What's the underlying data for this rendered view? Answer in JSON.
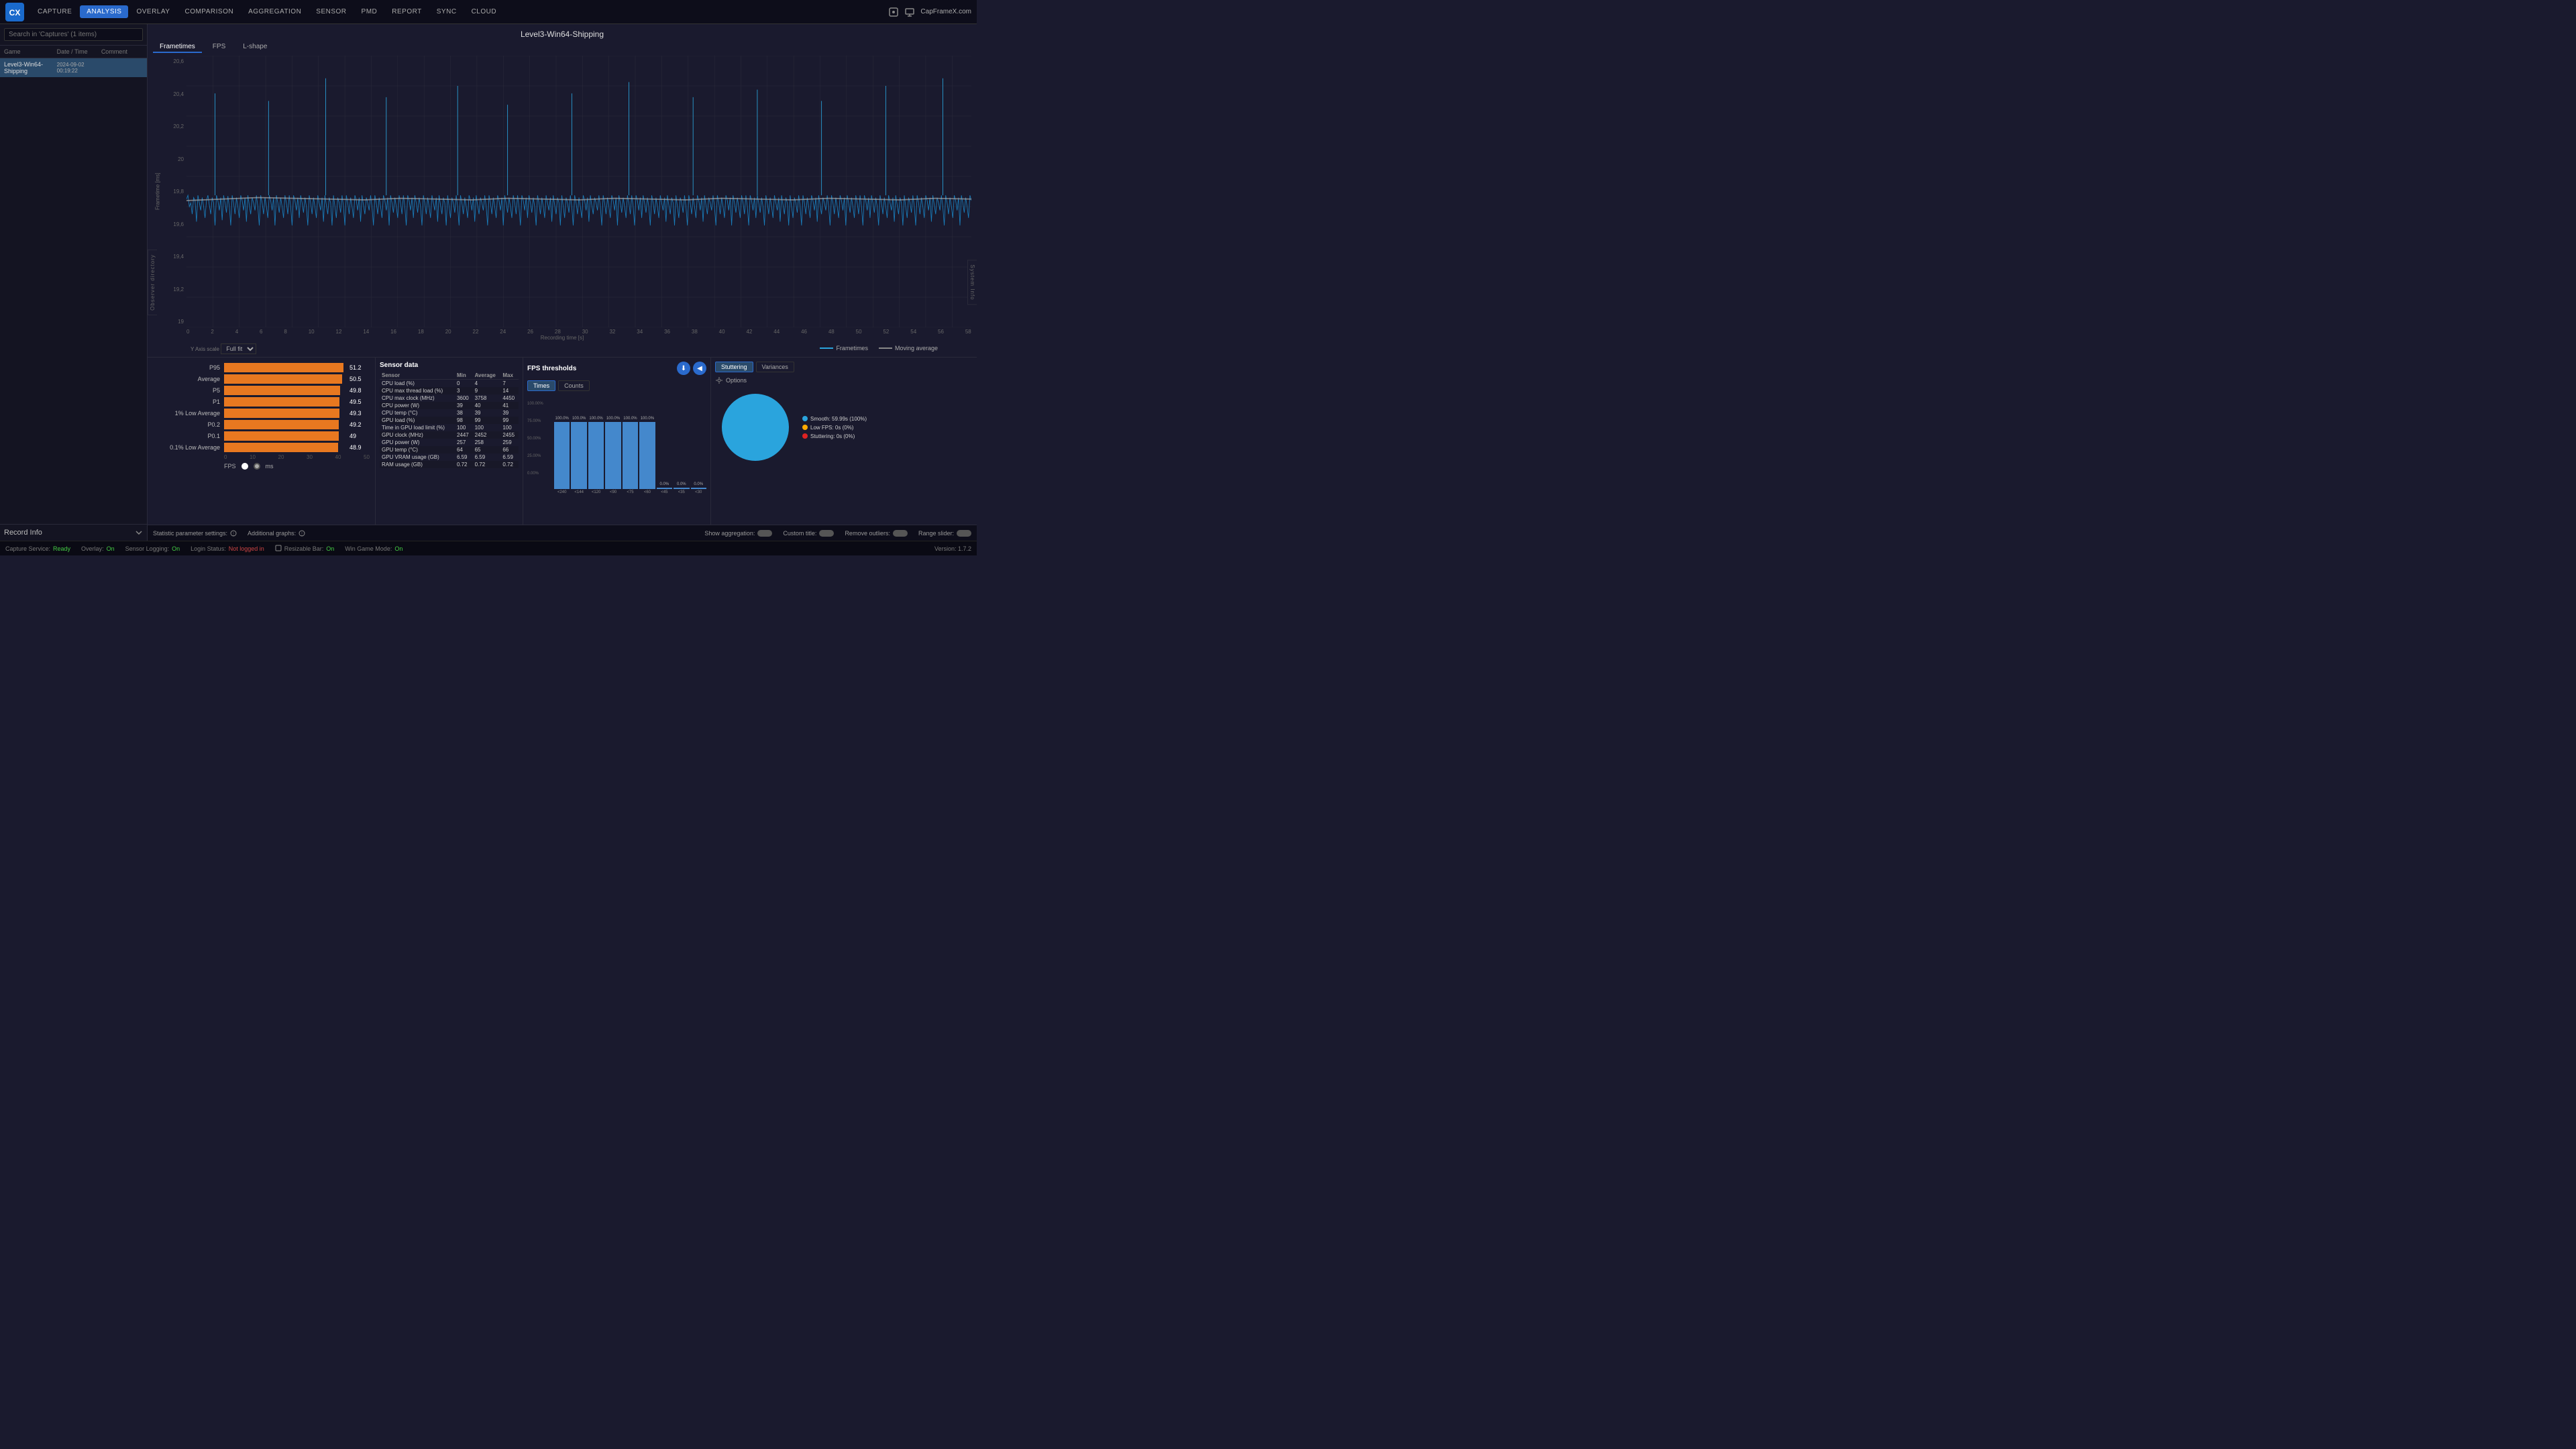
{
  "app": {
    "title": "CapFrameX",
    "brand": "CapFrameX.com"
  },
  "nav": {
    "items": [
      {
        "label": "CAPTURE",
        "active": false
      },
      {
        "label": "ANALYSIS",
        "active": true
      },
      {
        "label": "OVERLAY",
        "active": false
      },
      {
        "label": "COMPARISON",
        "active": false
      },
      {
        "label": "AGGREGATION",
        "active": false
      },
      {
        "label": "SENSOR",
        "active": false
      },
      {
        "label": "PMD",
        "active": false
      },
      {
        "label": "REPORT",
        "active": false
      },
      {
        "label": "SYNC",
        "active": false
      },
      {
        "label": "CLOUD",
        "active": false
      }
    ]
  },
  "sidebar": {
    "search_placeholder": "Search in 'Captures' (1 items)",
    "col_game": "Game",
    "col_date": "Date / Time",
    "col_comment": "Comment",
    "captures": [
      {
        "game": "Level3-Win64-Shipping",
        "date": "2024-09-02",
        "time": "00:19:22",
        "comment": ""
      }
    ],
    "record_info": "Record Info"
  },
  "chart": {
    "title": "Level3-Win64-Shipping",
    "tabs": [
      "Frametimes",
      "FPS",
      "L-shape"
    ],
    "active_tab": "Frametimes",
    "y_label": "Frametime [ms]",
    "x_label": "Recording time [s]",
    "y_axis": [
      "20,6",
      "20,4",
      "20,2",
      "20",
      "19,8",
      "19,6",
      "19,4",
      "19,2",
      "19"
    ],
    "x_axis": [
      "0",
      "2",
      "4",
      "6",
      "8",
      "10",
      "12",
      "14",
      "16",
      "18",
      "20",
      "22",
      "24",
      "26",
      "28",
      "30",
      "32",
      "34",
      "36",
      "38",
      "40",
      "42",
      "44",
      "46",
      "48",
      "50",
      "52",
      "54",
      "56",
      "58"
    ],
    "legend": {
      "frametimes_label": "Frametimes",
      "moving_avg_label": "Moving average",
      "frametimes_color": "#2aa4dd",
      "moving_avg_color": "#888"
    },
    "y_axis_scale_label": "Y Axis scale",
    "y_axis_scale_value": "Full fit"
  },
  "bar_chart": {
    "rows": [
      {
        "label": "P95",
        "value": 51.2,
        "max": 52
      },
      {
        "label": "Average",
        "value": 50.5,
        "max": 52
      },
      {
        "label": "P5",
        "value": 49.8,
        "max": 52
      },
      {
        "label": "P1",
        "value": 49.5,
        "max": 52
      },
      {
        "label": "1% Low Average",
        "value": 49.3,
        "max": 52
      },
      {
        "label": "P0.2",
        "value": 49.2,
        "max": 52
      },
      {
        "label": "P0.1",
        "value": 49,
        "max": 52
      },
      {
        "label": "0.1% Low Average",
        "value": 48.9,
        "max": 52
      }
    ],
    "x_ticks": [
      "0",
      "10",
      "20",
      "30",
      "40",
      "50"
    ],
    "unit_fps": "FPS",
    "unit_ms": "ms"
  },
  "sensor": {
    "title": "Sensor data",
    "headers": [
      "Sensor",
      "Min",
      "Average",
      "Max"
    ],
    "rows": [
      [
        "CPU load (%)",
        "0",
        "4",
        "7"
      ],
      [
        "CPU max thread load (%)",
        "3",
        "9",
        "14"
      ],
      [
        "CPU max clock (MHz)",
        "3600",
        "3758",
        "4450"
      ],
      [
        "CPU power (W)",
        "39",
        "40",
        "41"
      ],
      [
        "CPU temp (°C)",
        "38",
        "39",
        "39"
      ],
      [
        "GPU load (%)",
        "98",
        "99",
        "99"
      ],
      [
        "Time in GPU load limit (%)",
        "100",
        "100",
        "100"
      ],
      [
        "GPU clock (MHz)",
        "2447",
        "2452",
        "2455"
      ],
      [
        "GPU power (W)",
        "257",
        "258",
        "259"
      ],
      [
        "GPU temp (°C)",
        "64",
        "65",
        "66"
      ],
      [
        "GPU VRAM usage (GB)",
        "6.59",
        "6.59",
        "6.59"
      ],
      [
        "RAM usage (GB)",
        "0.72",
        "0.72",
        "0.72"
      ]
    ]
  },
  "fps_thresholds": {
    "title": "FPS thresholds",
    "tabs": [
      "Times",
      "Counts"
    ],
    "active_tab": "Times",
    "bars": [
      {
        "label": "<240",
        "pct": "100.0%",
        "value": 100
      },
      {
        "label": "<144",
        "pct": "100.0%",
        "value": 100
      },
      {
        "label": "<120",
        "pct": "100.0%",
        "value": 100
      },
      {
        "label": "<90",
        "pct": "100.0%",
        "value": 100
      },
      {
        "label": "<75",
        "pct": "100.0%",
        "value": 100
      },
      {
        "label": "<60",
        "pct": "100.0%",
        "value": 100
      },
      {
        "label": "<45",
        "pct": "0.0%",
        "value": 0
      },
      {
        "label": "<35",
        "pct": "0.0%",
        "value": 0
      },
      {
        "label": "<30",
        "pct": "0.0%",
        "value": 0
      }
    ],
    "y_ticks": [
      "100.00%",
      "75.00%",
      "50.00%",
      "25.00%",
      "0.00%"
    ]
  },
  "stutter": {
    "tabs": [
      "Stuttering",
      "Variances"
    ],
    "active_tab": "Stuttering",
    "options_label": "Options",
    "pie": {
      "smooth_pct": 100,
      "low_fps_pct": 0,
      "stutter_pct": 0
    },
    "legend": [
      {
        "label": "Smooth: 59.99s (100%)",
        "color": "#2aa4dd"
      },
      {
        "label": "Low FPS: 0s (0%)",
        "color": "#ffaa00"
      },
      {
        "label": "Stuttering: 0s (0%)",
        "color": "#dd2222"
      }
    ]
  },
  "params_bar": {
    "show_aggregation_label": "Show aggregation:",
    "custom_title_label": "Custom title:",
    "remove_outliers_label": "Remove outliers:",
    "range_slider_label": "Range slider:",
    "statistic_parameter_label": "Statistic parameter settings:",
    "additional_graphs_label": "Additional graphs:"
  },
  "statusbar": {
    "capture_service": "Capture Service:",
    "capture_status": "Ready",
    "overlay": "Overlay:",
    "overlay_status": "On",
    "sensor_logging": "Sensor Logging:",
    "sensor_status": "On",
    "login_status": "Login Status:",
    "login_value": "Not logged in",
    "resizable_bar": "Resizable Bar:",
    "resizable_value": "On",
    "win_game_mode": "Win Game Mode:",
    "game_mode_value": "On",
    "version": "Version: 1.7.2"
  },
  "obs_directory_label": "Observer directory",
  "system_info_label": "System Info"
}
